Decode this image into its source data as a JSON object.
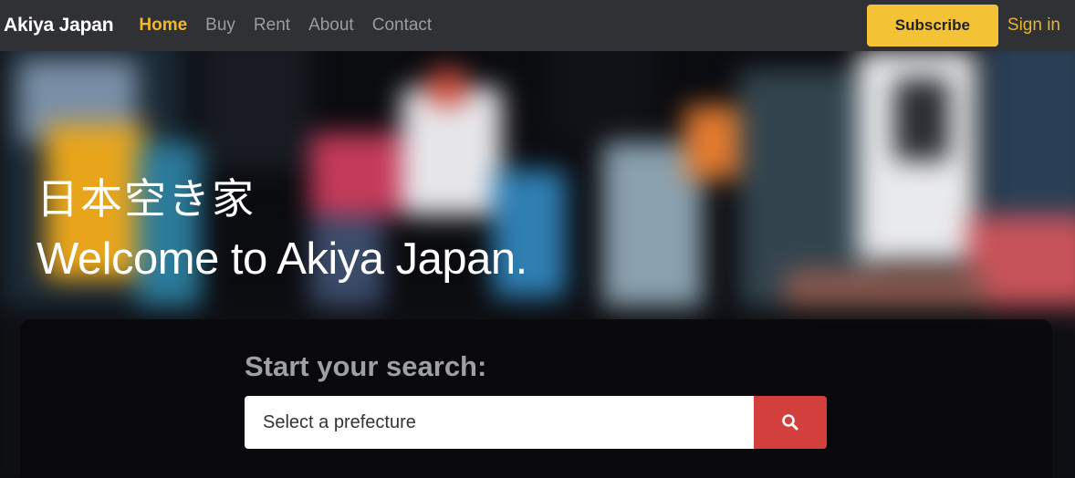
{
  "navbar": {
    "brand": "Akiya Japan",
    "links": [
      {
        "label": "Home",
        "active": true
      },
      {
        "label": "Buy",
        "active": false
      },
      {
        "label": "Rent",
        "active": false
      },
      {
        "label": "About",
        "active": false
      },
      {
        "label": "Contact",
        "active": false
      }
    ],
    "subscribe_label": "Subscribe",
    "signin_label": "Sign in"
  },
  "hero": {
    "title_jp": "日本空き家",
    "title_en": "Welcome to Akiya Japan."
  },
  "search": {
    "title": "Start your search:",
    "placeholder": "Select a prefecture",
    "button_icon": "search-icon"
  },
  "colors": {
    "navbar_bg": "#2f3134",
    "accent_yellow": "#f4c235",
    "active_link": "#f3b72a",
    "search_button": "#d33f3c"
  }
}
